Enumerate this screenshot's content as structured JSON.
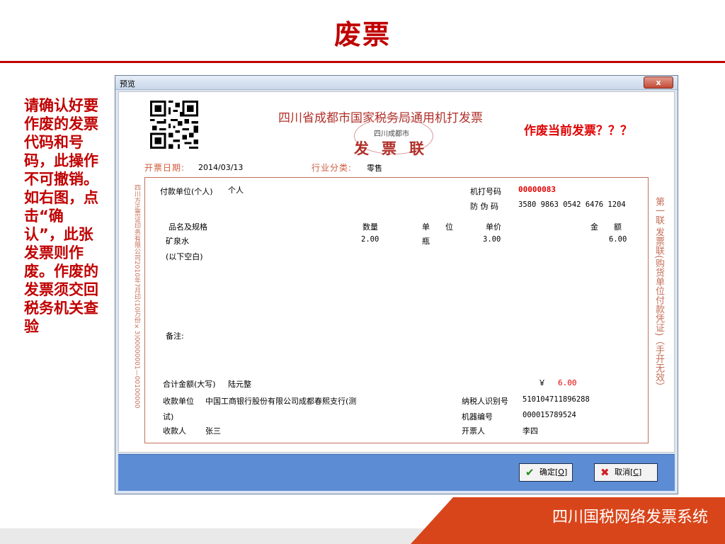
{
  "slide": {
    "title": "废票",
    "instructions": "请确认好要作废的发票代码和号码，此操作不可撤销。如右图，点击“确认”，此张发票则作废。作废的发票须交回税务机关查验",
    "footer": "四川国税网络发票系统"
  },
  "window": {
    "title": "预览",
    "close_label": "x",
    "ok_label": "确定[O]",
    "ok_hotkey": "O",
    "cancel_label": "取消[C]",
    "cancel_hotkey": "C"
  },
  "invoice": {
    "title": "四川省成都市国家税务局通用机打发票",
    "seal_city": "四川成都市",
    "copy_name": "发票联",
    "confirm_prompt": "作废当前发票？？？",
    "date_label": "开票日期:",
    "date": "2014/03/13",
    "industry_label": "行业分类:",
    "industry": "零售",
    "payer_label": "付款单位(个人)",
    "payer": "个人",
    "machine_no_label": "机打号码",
    "machine_no": "00000083",
    "anti_fake_label": "防 伪 码",
    "anti_fake": "3580 9863 0542 6476 1204",
    "columns": {
      "name": "品名及规格",
      "qty": "数量",
      "unit": "单　　位",
      "price": "单价",
      "amount": "金　　额"
    },
    "items": [
      {
        "name": "矿泉水",
        "qty": "2.00",
        "unit": "瓶",
        "price": "3.00",
        "amount": "6.00"
      }
    ],
    "blank_note": "(以下空白)",
    "remark_label": "备注:",
    "total_label": "合计金额(大写)",
    "total_caps": "陆元整",
    "currency": "￥",
    "total": "6.00",
    "payee_unit_label": "收款单位",
    "payee_unit_line1": "中国工商银行股份有限公司成都春熙支行(测",
    "payee_unit_line2": "试)",
    "tax_id_label": "纳税人识别号",
    "tax_id": "510104711896288",
    "device_no_label": "机器编号",
    "device_no": "000015789524",
    "payee_label": "收款人",
    "payee": "张三",
    "drawer_label": "开票人",
    "drawer": "李四",
    "side_left": "四川方正票证印务有限公司2010年7月印(10万份×3)00000001—00100000",
    "side_right": "第一联 发票联(购货单位付款凭证)（手开无效）"
  },
  "colors": {
    "accent_red": "#c00000",
    "footer_orange": "#d9451a",
    "panel_blue": "#5b8cd4",
    "invoice_frame": "#c56f5a"
  }
}
